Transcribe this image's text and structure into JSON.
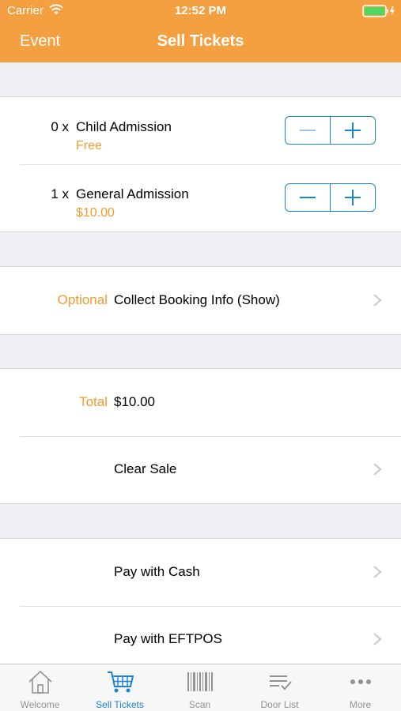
{
  "status_bar": {
    "carrier": "Carrier",
    "time": "12:52 PM"
  },
  "nav": {
    "back_label": "Event",
    "title": "Sell Tickets"
  },
  "tickets": [
    {
      "quantity": "0 x",
      "name": "Child Admission",
      "price": "Free"
    },
    {
      "quantity": "1 x",
      "name": "General Admission",
      "price": "$10.00"
    }
  ],
  "booking": {
    "label": "Optional",
    "text": "Collect Booking Info (Show)"
  },
  "summary": {
    "total_label": "Total",
    "total_value": "$10.00",
    "clear_label": "Clear Sale"
  },
  "payment": {
    "cash_label": "Pay with Cash",
    "eftpos_label": "Pay with EFTPOS"
  },
  "tabs": [
    {
      "label": "Welcome",
      "icon": "home-icon",
      "active": false
    },
    {
      "label": "Sell Tickets",
      "icon": "cart-icon",
      "active": true
    },
    {
      "label": "Scan",
      "icon": "barcode-icon",
      "active": false
    },
    {
      "label": "Door List",
      "icon": "checklist-icon",
      "active": false
    },
    {
      "label": "More",
      "icon": "more-icon",
      "active": false
    }
  ],
  "colors": {
    "nav_bar": "#f5a040",
    "accent_orange": "#f29a2e",
    "accent_blue": "#1a84d6",
    "inactive_tab": "#929292"
  }
}
